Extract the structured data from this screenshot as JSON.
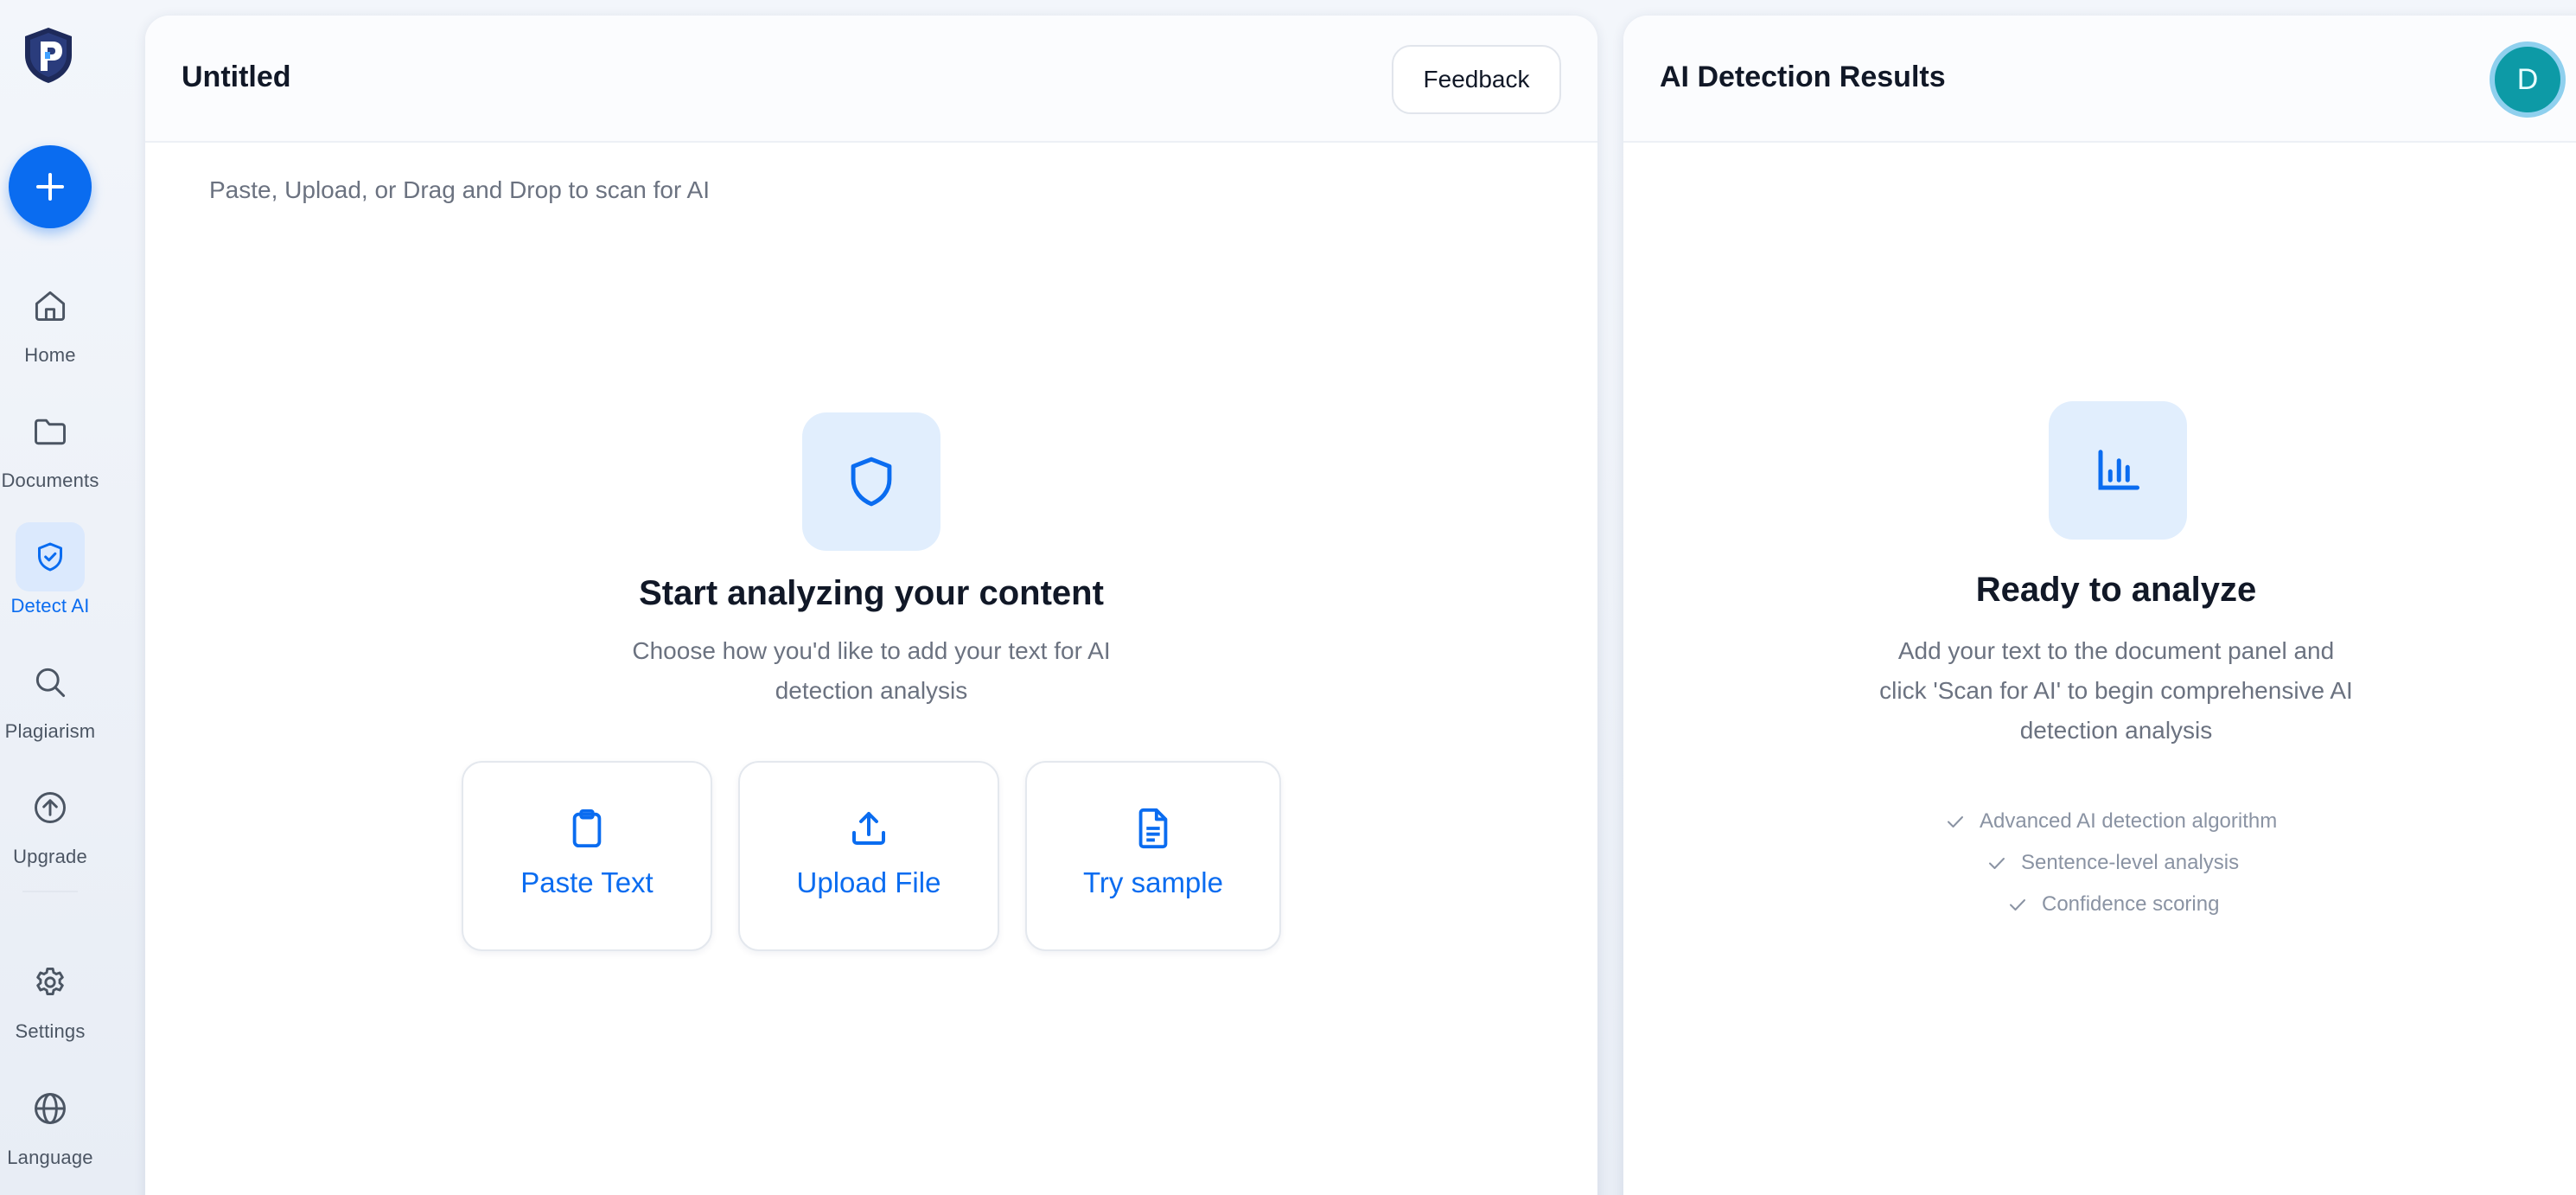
{
  "sidebar": {
    "items": [
      {
        "label": "Home",
        "icon": "home-icon"
      },
      {
        "label": "Documents",
        "icon": "folder-icon"
      },
      {
        "label": "Detect AI",
        "icon": "shield-check-icon",
        "active": true
      },
      {
        "label": "Plagiarism",
        "icon": "search-icon"
      },
      {
        "label": "Upgrade",
        "icon": "arrow-up-circle-icon"
      },
      {
        "label": "Settings",
        "icon": "gear-icon"
      },
      {
        "label": "Language",
        "icon": "globe-icon"
      }
    ]
  },
  "editor": {
    "title": "Untitled",
    "feedback_label": "Feedback",
    "placeholder": "Paste, Upload, or Drag and Drop to scan for AI",
    "hero_title": "Start analyzing your content",
    "hero_subtitle_line1": "Choose how you'd like to add your text for AI",
    "hero_subtitle_line2": "detection analysis",
    "options": [
      {
        "label": "Paste Text",
        "icon": "clipboard-icon"
      },
      {
        "label": "Upload File",
        "icon": "upload-icon"
      },
      {
        "label": "Try sample",
        "icon": "document-icon"
      }
    ]
  },
  "results": {
    "title": "AI Detection Results",
    "avatar_initial": "D",
    "hero_title": "Ready to analyze",
    "hero_subtitle_line1": "Add your text to the document panel and",
    "hero_subtitle_line2": "click 'Scan for AI' to begin comprehensive AI",
    "hero_subtitle_line3": "detection analysis",
    "features": [
      "Advanced AI detection algorithm",
      "Sentence-level analysis",
      "Confidence scoring"
    ]
  },
  "colors": {
    "accent": "#0a6cf0",
    "icon_bg": "#e1eefd",
    "avatar": "#0d9aa6"
  }
}
